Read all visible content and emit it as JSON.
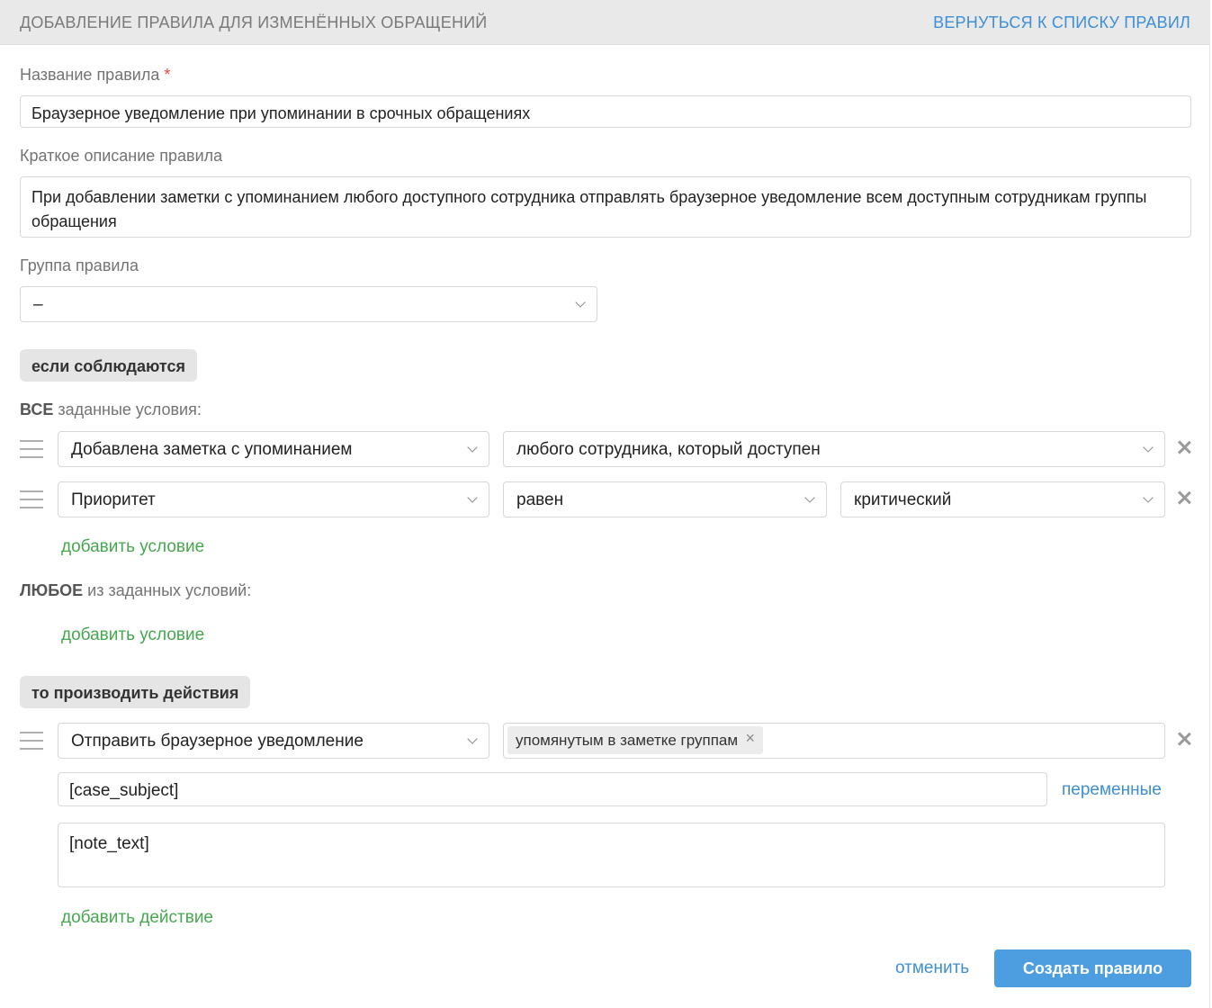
{
  "header": {
    "title": "ДОБАВЛЕНИЕ ПРАВИЛА ДЛЯ ИЗМЕНЁННЫХ ОБРАЩЕНИЙ",
    "back_link": "ВЕРНУТЬСЯ К СПИСКУ ПРАВИЛ"
  },
  "form": {
    "name_label": "Название правила",
    "name_required_mark": "*",
    "name_value": "Браузерное уведомление при упоминании в срочных обращениях",
    "description_label": "Краткое описание правила",
    "description_value": "При добавлении заметки с упоминанием любого доступного сотрудника отправлять браузерное уведомление всем доступным сотрудникам группы обращения",
    "group_label": "Группа правила",
    "group_value": "–"
  },
  "conditions": {
    "section_label": "если соблюдаются",
    "all_prefix": "ВСЕ",
    "all_suffix": " заданные условия:",
    "all_rows": [
      {
        "field": "Добавлена заметка с упоминанием",
        "operator": "любого сотрудника, который доступен"
      },
      {
        "field": "Приоритет",
        "operator": "равен",
        "value": "критический"
      }
    ],
    "add_condition_all": "добавить условие",
    "any_prefix": "ЛЮБОЕ",
    "any_suffix": " из заданных условий:",
    "add_condition_any": "добавить условие"
  },
  "actions": {
    "section_label": "то производить действия",
    "rows": [
      {
        "action": "Отправить браузерное уведомление",
        "recipient_tag": "упомянутым в заметке группам",
        "subject": "[case_subject]",
        "body": "[note_text]",
        "variables_link": "переменные"
      }
    ],
    "add_action": "добавить действие"
  },
  "footer": {
    "cancel": "отменить",
    "submit": "Создать правило"
  },
  "colors": {
    "accent_blue": "#4d9ee0",
    "link_blue": "#3d8fd6",
    "link_green": "#45a84e",
    "required_red": "#e0483c"
  }
}
